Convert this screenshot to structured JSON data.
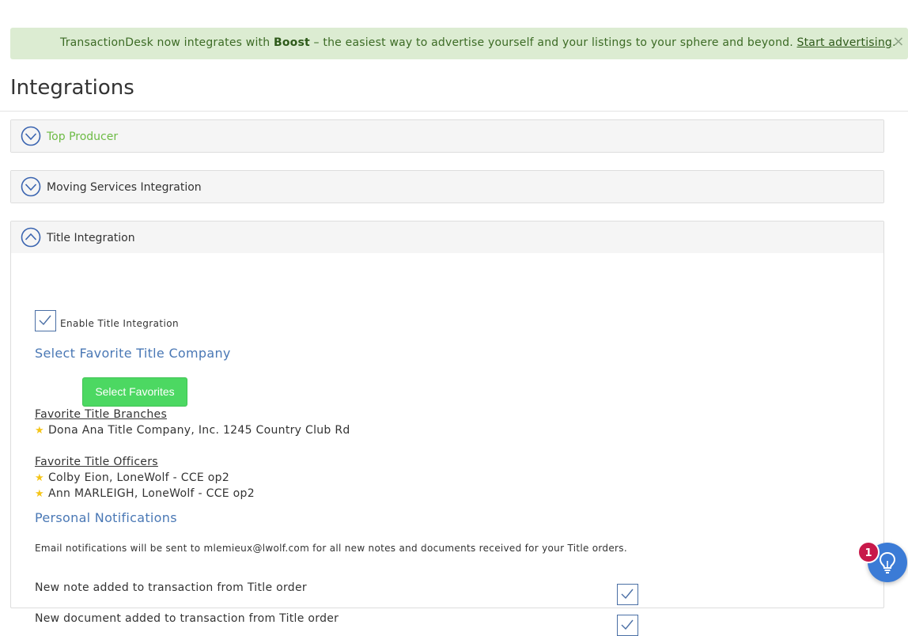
{
  "banner": {
    "prefix": "TransactionDesk now integrates with ",
    "brand": "Boost",
    "middle": " – the easiest way to advertise yourself and your listings to your sphere and beyond. ",
    "link": "Start advertising",
    "suffix": ".",
    "close": "×"
  },
  "page": {
    "title": "Integrations"
  },
  "panels": {
    "top_producer": {
      "title": "Top Producer",
      "expanded": false
    },
    "moving": {
      "title": "Moving Services Integration",
      "expanded": false
    },
    "title_integration": {
      "title": "Title Integration",
      "expanded": true,
      "enable_label": "Enable Title Integration",
      "enable_checked": true,
      "favorite_company_heading": "Select Favorite Title Company",
      "select_favorites_button": "Select Favorites",
      "favorite_branches_heading": "Favorite Title Branches",
      "favorite_branches": [
        "Dona Ana Title Company, Inc. 1245 Country Club Rd"
      ],
      "favorite_officers_heading": "Favorite Title Officers",
      "favorite_officers": [
        "Colby Eion, LoneWolf - CCE op2",
        "Ann MARLEIGH, LoneWolf - CCE op2"
      ],
      "notifications_heading": "Personal Notifications",
      "notifications_text": "Email notifications will be sent to mlemieux@lwolf.com for all new notes and documents received for your Title orders.",
      "notification_options": [
        {
          "label": "New note added to transaction from Title order",
          "checked": true
        },
        {
          "label": "New document added to transaction from Title order",
          "checked": true
        }
      ]
    }
  },
  "help": {
    "badge_count": "1",
    "icon": "lightbulb-icon"
  },
  "colors": {
    "banner_bg": "#dcecd2",
    "accent_blue": "#4a78b5",
    "green_button": "#4cd862",
    "top_producer_green": "#6dbb45",
    "badge_red": "#c8194a"
  }
}
